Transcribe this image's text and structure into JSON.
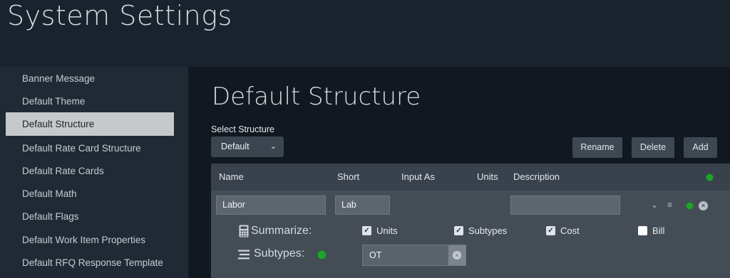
{
  "app": {
    "title": "System Settings"
  },
  "sidebar": {
    "items": [
      {
        "label": "Banner Message"
      },
      {
        "label": "Default Theme"
      },
      {
        "label": "Default Structure"
      },
      {
        "label": "Default Rate Card Structure"
      },
      {
        "label": "Default Rate Cards"
      },
      {
        "label": "Default Math"
      },
      {
        "label": "Default Flags"
      },
      {
        "label": "Default Work Item Properties"
      },
      {
        "label": "Default RFQ Response Template"
      }
    ],
    "active_index": 2
  },
  "main": {
    "title": "Default Structure",
    "select": {
      "label": "Select Structure",
      "value": "Default"
    },
    "buttons": {
      "rename": "Rename",
      "delete": "Delete",
      "add": "Add"
    },
    "table": {
      "headers": {
        "name": "Name",
        "short": "Short",
        "input_as": "Input As",
        "units": "Units",
        "description": "Description"
      },
      "row": {
        "name": "Labor",
        "short": "Lab",
        "description": "",
        "summarize": {
          "label": "Summarize:",
          "options": [
            {
              "label": "Units",
              "checked": true
            },
            {
              "label": "Subtypes",
              "checked": true
            },
            {
              "label": "Cost",
              "checked": true
            },
            {
              "label": "Bill",
              "checked": false
            }
          ]
        },
        "subtypes": {
          "label": "Subtypes:",
          "value": "OT"
        }
      }
    }
  },
  "colors": {
    "active_green": "#22a32e",
    "sidebar_active": "#c6c9cc",
    "background": "#1a232d"
  }
}
